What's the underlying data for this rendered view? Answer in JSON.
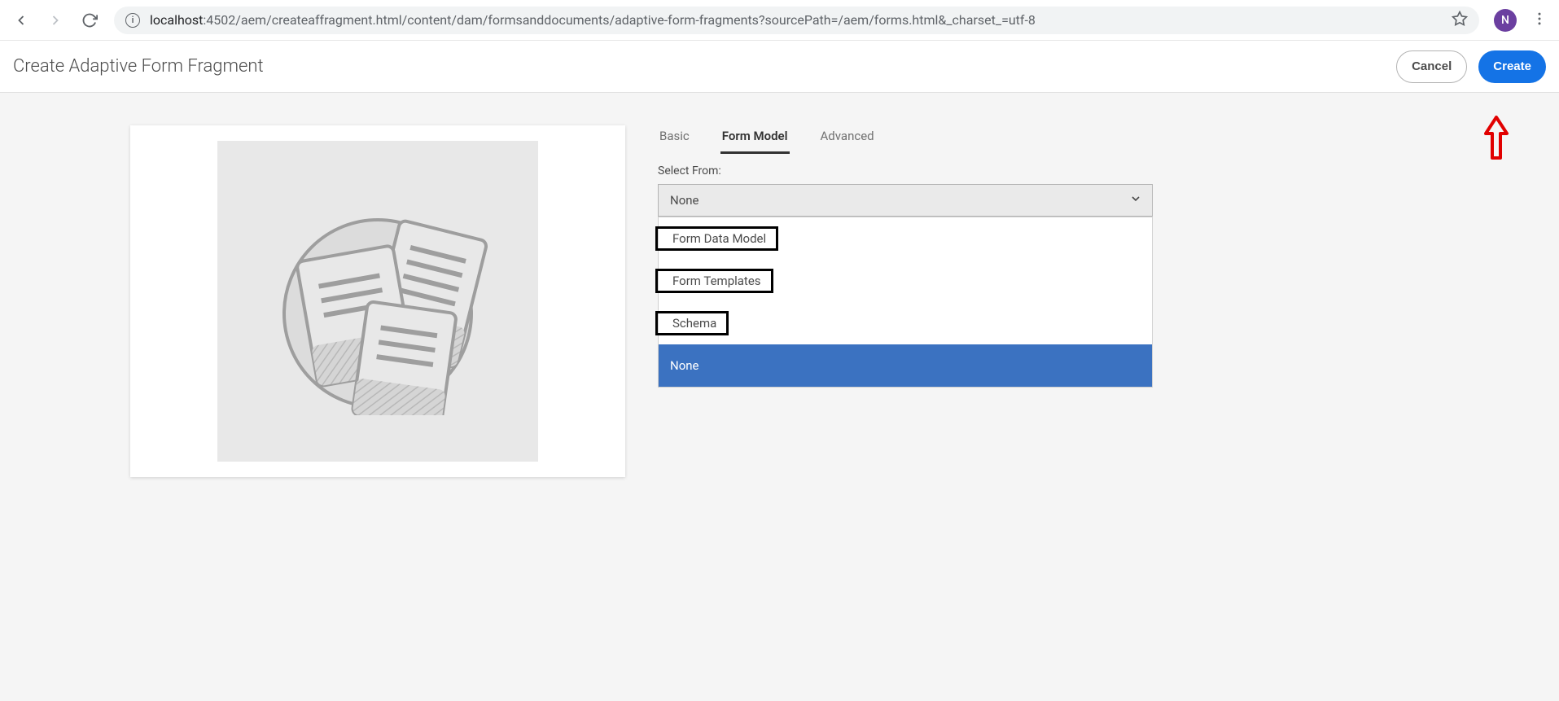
{
  "browser": {
    "url_host": "localhost",
    "url_path": ":4502/aem/createaffragment.html/content/dam/formsanddocuments/adaptive-form-fragments?sourcePath=/aem/forms.html&_charset_=utf-8",
    "avatar_initial": "N"
  },
  "header": {
    "title": "Create Adaptive Form Fragment",
    "cancel_label": "Cancel",
    "create_label": "Create"
  },
  "tabs": [
    {
      "label": "Basic",
      "active": false
    },
    {
      "label": "Form Model",
      "active": true
    },
    {
      "label": "Advanced",
      "active": false
    }
  ],
  "form": {
    "select_from_label": "Select From:",
    "select_value": "None"
  },
  "dropdown_options": [
    {
      "label": "Form Data Model",
      "boxed": true,
      "selected": false
    },
    {
      "label": "Form Templates",
      "boxed": true,
      "selected": false
    },
    {
      "label": "Schema",
      "boxed": true,
      "selected": false
    },
    {
      "label": "None",
      "boxed": false,
      "selected": true
    }
  ]
}
